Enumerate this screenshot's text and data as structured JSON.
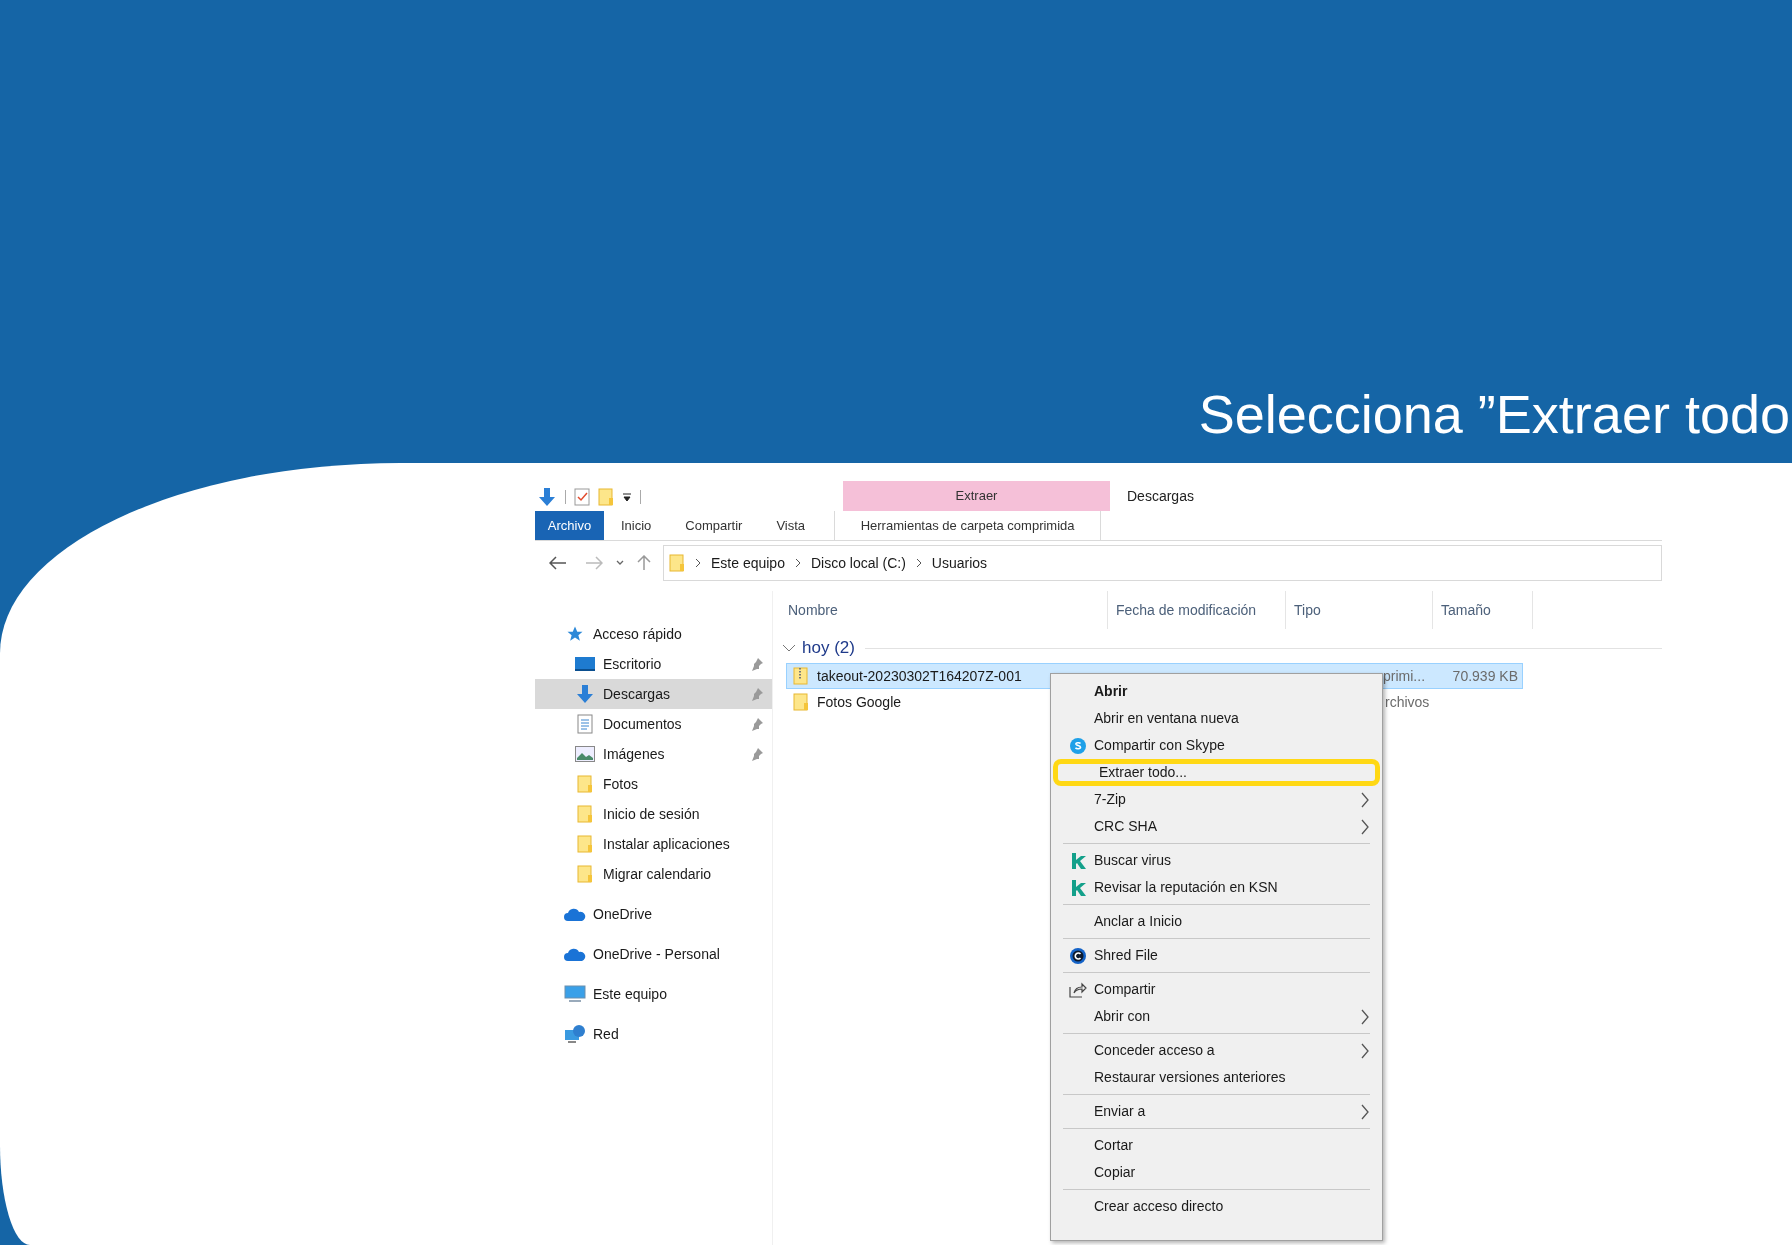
{
  "slide_title": "Selecciona ”Extraer todo",
  "window": {
    "context_group": "Extraer",
    "title": "Descargas"
  },
  "tabs": [
    {
      "label": "Archivo",
      "kind": "file"
    },
    {
      "label": "Inicio",
      "kind": "tab"
    },
    {
      "label": "Compartir",
      "kind": "tab"
    },
    {
      "label": "Vista",
      "kind": "tab"
    },
    {
      "label": "Herramientas de carpeta comprimida",
      "kind": "context"
    }
  ],
  "breadcrumb": [
    "Este equipo",
    "Disco local (C:)",
    "Usuarios"
  ],
  "sidebar": {
    "items": [
      {
        "label": "Acceso rápido",
        "kind": "star",
        "selected": false,
        "pinned": false,
        "children": [
          {
            "label": "Escritorio",
            "kind": "desktop",
            "selected": false,
            "pinned": true
          },
          {
            "label": "Descargas",
            "kind": "download",
            "selected": true,
            "pinned": true
          },
          {
            "label": "Documentos",
            "kind": "document",
            "selected": false,
            "pinned": true
          },
          {
            "label": "Imágenes",
            "kind": "picture",
            "selected": false,
            "pinned": true
          },
          {
            "label": "Fotos",
            "kind": "folder",
            "selected": false,
            "pinned": false
          },
          {
            "label": "Inicio de sesión",
            "kind": "folder",
            "selected": false,
            "pinned": false
          },
          {
            "label": "Instalar aplicaciones",
            "kind": "folder",
            "selected": false,
            "pinned": false
          },
          {
            "label": "Migrar calendario",
            "kind": "folder",
            "selected": false,
            "pinned": false
          }
        ]
      },
      {
        "label": "OneDrive",
        "kind": "cloud",
        "selected": false,
        "pinned": false
      },
      {
        "label": "OneDrive - Personal",
        "kind": "cloud",
        "selected": false,
        "pinned": false
      },
      {
        "label": "Este equipo",
        "kind": "pc",
        "selected": false,
        "pinned": false
      },
      {
        "label": "Red",
        "kind": "network",
        "selected": false,
        "pinned": false
      }
    ]
  },
  "table": {
    "columns": [
      "Nombre",
      "Fecha de modificación",
      "Tipo",
      "Tamaño"
    ],
    "group": {
      "label": "hoy (2)",
      "expanded": true
    },
    "rows": [
      {
        "name": "takeout-20230302T164207Z-001",
        "kind": "zip",
        "type": "primi...",
        "size": "70.939 KB",
        "selected": true
      },
      {
        "name": "Fotos Google",
        "kind": "folder",
        "type": "rchivos",
        "selected": false
      }
    ]
  },
  "context_menu": {
    "groups": [
      [
        {
          "label": "Abrir",
          "kind": "plain",
          "default": true,
          "highlighted": false,
          "submenu": false
        },
        {
          "label": "Abrir en ventana nueva",
          "kind": "plain",
          "default": false,
          "highlighted": false,
          "submenu": false
        },
        {
          "label": "Compartir con Skype",
          "kind": "skype",
          "default": false,
          "highlighted": false,
          "submenu": false
        },
        {
          "label": "Extraer todo...",
          "kind": "plain",
          "default": false,
          "highlighted": true,
          "submenu": false
        },
        {
          "label": "7-Zip",
          "kind": "plain",
          "default": false,
          "highlighted": false,
          "submenu": true
        },
        {
          "label": "CRC SHA",
          "kind": "plain",
          "default": false,
          "highlighted": false,
          "submenu": true
        }
      ],
      [
        {
          "label": "Buscar virus",
          "kind": "k",
          "default": false,
          "highlighted": false,
          "submenu": false
        },
        {
          "label": "Revisar la reputación en KSN",
          "kind": "k",
          "default": false,
          "highlighted": false,
          "submenu": false
        }
      ],
      [
        {
          "label": "Anclar a Inicio",
          "kind": "plain",
          "default": false,
          "highlighted": false,
          "submenu": false
        }
      ],
      [
        {
          "label": "Shred File",
          "kind": "shred",
          "default": false,
          "highlighted": false,
          "submenu": false
        }
      ],
      [
        {
          "label": "Compartir",
          "kind": "share",
          "default": false,
          "highlighted": false,
          "submenu": false
        },
        {
          "label": "Abrir con",
          "kind": "plain",
          "default": false,
          "highlighted": false,
          "submenu": true
        }
      ],
      [
        {
          "label": "Conceder acceso a",
          "kind": "plain",
          "default": false,
          "highlighted": false,
          "submenu": true
        },
        {
          "label": "Restaurar versiones anteriores",
          "kind": "plain",
          "default": false,
          "highlighted": false,
          "submenu": false
        }
      ],
      [
        {
          "label": "Enviar a",
          "kind": "plain",
          "default": false,
          "highlighted": false,
          "submenu": true
        }
      ],
      [
        {
          "label": "Cortar",
          "kind": "plain",
          "default": false,
          "highlighted": false,
          "submenu": false
        },
        {
          "label": "Copiar",
          "kind": "plain",
          "default": false,
          "highlighted": false,
          "submenu": false
        }
      ],
      [
        {
          "label": "Crear acceso directo",
          "kind": "plain",
          "default": false,
          "highlighted": false,
          "submenu": false
        }
      ]
    ]
  }
}
